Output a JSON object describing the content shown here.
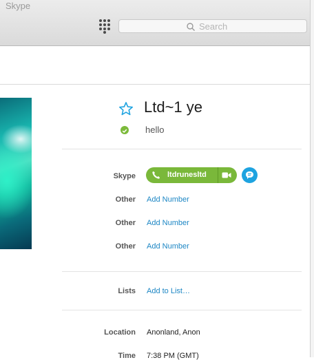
{
  "window": {
    "title": "Skype"
  },
  "toolbar": {
    "search_placeholder": "Search"
  },
  "profile": {
    "display_name": "Ltd~1 ye",
    "mood": "hello",
    "presence_color": "#7cba3b"
  },
  "contact": {
    "skype": {
      "label": "Skype",
      "username": "ltdrunesltd"
    },
    "phones": [
      {
        "label": "Other",
        "action": "Add Number"
      },
      {
        "label": "Other",
        "action": "Add Number"
      },
      {
        "label": "Other",
        "action": "Add Number"
      }
    ],
    "lists": {
      "label": "Lists",
      "action": "Add to List…"
    },
    "location": {
      "label": "Location",
      "value": "Anonland, Anon"
    },
    "time": {
      "label": "Time",
      "value": "7:38 PM (GMT)"
    }
  },
  "colors": {
    "accent_green": "#7ab83a",
    "link_blue": "#1c86c4",
    "chat_blue": "#1ea3e0"
  }
}
